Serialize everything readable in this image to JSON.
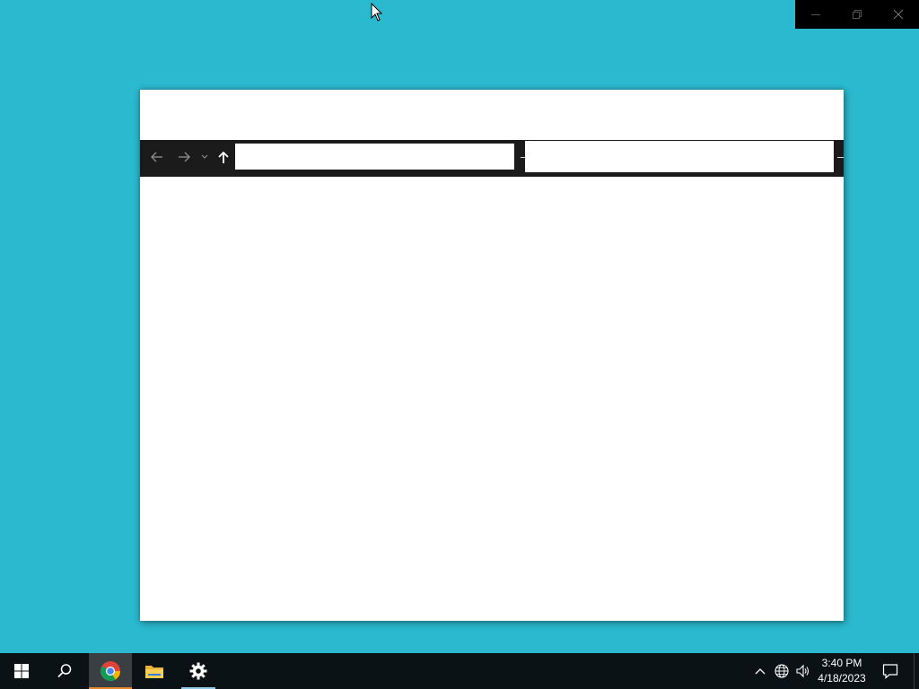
{
  "caption_buttons": {
    "minimize_icon": "minimize-icon",
    "restore_icon": "restore-icon",
    "close_icon": "close-icon"
  },
  "explorer": {
    "address_value": "",
    "search_value": "",
    "nav": {
      "back_icon": "arrow-left-icon",
      "forward_icon": "arrow-right-icon",
      "recent_icon": "chevron-down-icon",
      "up_icon": "arrow-up-icon"
    }
  },
  "taskbar": {
    "apps": [
      {
        "name": "Start",
        "icon": "windows-logo-icon"
      },
      {
        "name": "Search",
        "icon": "search-icon"
      },
      {
        "name": "Chrome",
        "icon": "chrome-icon",
        "active": true
      },
      {
        "name": "File Explorer",
        "icon": "folder-icon"
      },
      {
        "name": "Settings",
        "icon": "gear-icon",
        "open": true
      }
    ],
    "tray": {
      "chevron_icon": "chevron-up-icon",
      "network_icon": "globe-network-icon",
      "volume_icon": "speaker-icon",
      "time": "3:40 PM",
      "date": "4/18/2023",
      "notification_icon": "notification-icon"
    }
  },
  "colors": {
    "desktop": "#2bb9cf",
    "taskbar": "#0b1215",
    "chrome_underline": "#e3862c",
    "settings_underline": "#8ec9e6"
  }
}
